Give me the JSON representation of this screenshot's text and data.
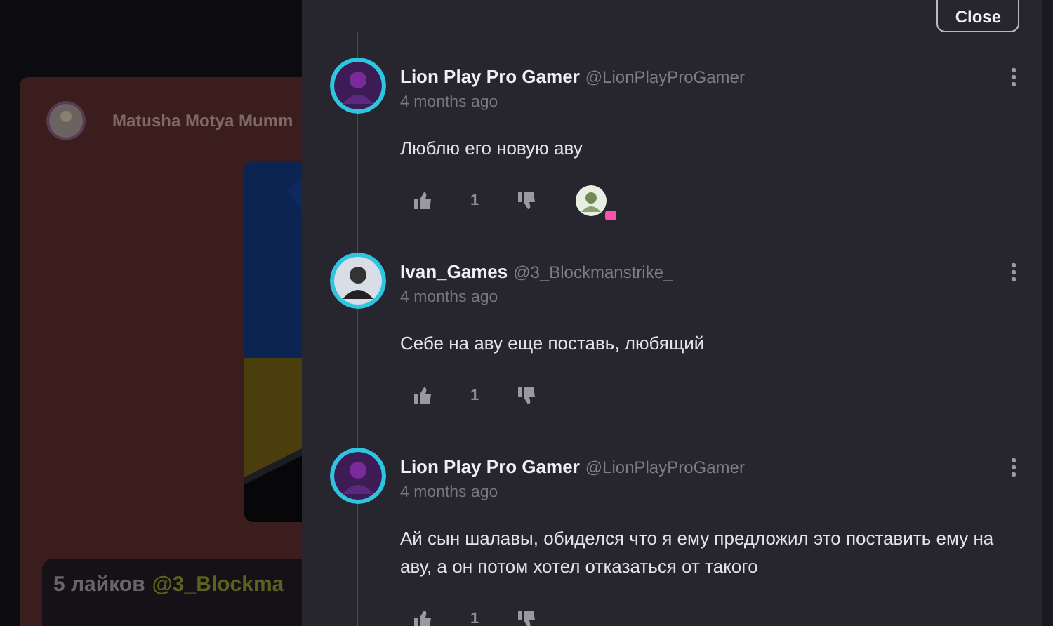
{
  "background_post": {
    "author": "Matusha Motya Mumm",
    "likes": "5 лайков",
    "mention": "@3_Blockma"
  },
  "close_button": "Close",
  "comments": [
    {
      "name": "Lion Play Pro Gamer",
      "handle": "@LionPlayProGamer",
      "time": "4 months ago",
      "text": "Люблю его новую аву",
      "likes": "1",
      "creator_heart": true
    },
    {
      "name": "Ivan_Games",
      "handle": "@3_Blockmanstrike_",
      "time": "4 months ago",
      "text": "Себе на аву еще поставь, любящий",
      "likes": "1",
      "creator_heart": false
    },
    {
      "name": "Lion Play Pro Gamer",
      "handle": "@LionPlayProGamer",
      "time": "4 months ago",
      "text": "Ай сын шалавы, обиделся что я ему предложил это поставить ему на аву, а он потом хотел отказаться от такого",
      "likes": "1",
      "creator_heart": false
    }
  ]
}
